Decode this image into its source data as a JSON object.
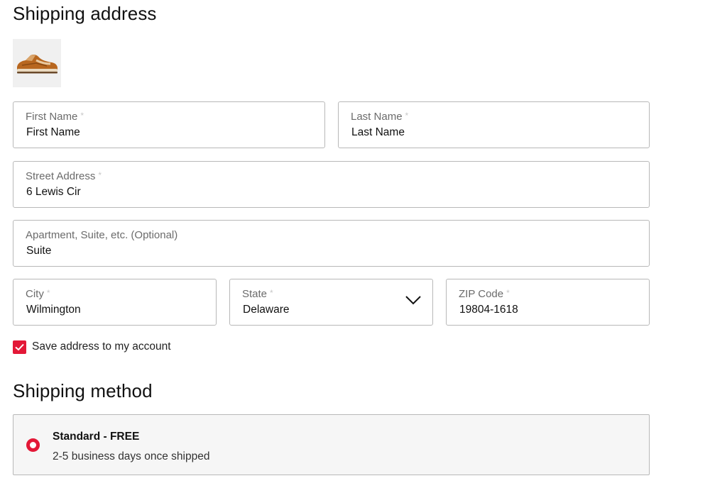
{
  "shipping_address": {
    "title": "Shipping address",
    "product_thumbnail_icon": "sneaker-icon",
    "fields": {
      "first_name": {
        "label": "First Name",
        "value": "First Name",
        "required_mark": "*"
      },
      "last_name": {
        "label": "Last Name",
        "value": "Last Name",
        "required_mark": "*"
      },
      "street": {
        "label": "Street Address",
        "value": "6 Lewis Cir",
        "required_mark": "*"
      },
      "apartment": {
        "label": "Apartment, Suite, etc. (Optional)",
        "value": "Suite"
      },
      "city": {
        "label": "City",
        "value": "Wilmington",
        "required_mark": "*"
      },
      "state": {
        "label": "State",
        "value": "Delaware",
        "required_mark": "*"
      },
      "zip": {
        "label": "ZIP Code",
        "value": "19804-1618",
        "required_mark": "*"
      }
    },
    "save_to_account": {
      "label": "Save address to my account",
      "checked": true
    }
  },
  "shipping_method": {
    "title": "Shipping method",
    "options": [
      {
        "name": "Standard - FREE",
        "description": "2-5 business days once shipped",
        "selected": true
      }
    ]
  },
  "colors": {
    "accent": "#e31837",
    "border": "#b8b8b8",
    "option_bg": "#f6f6f6"
  }
}
